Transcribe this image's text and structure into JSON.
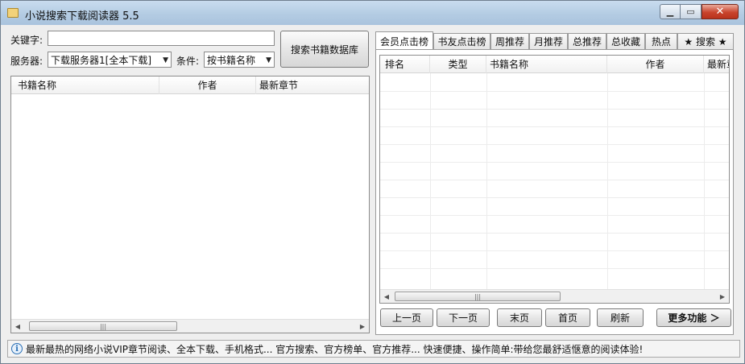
{
  "window": {
    "title": "小说搜索下载阅读器 5.5",
    "controls": {
      "minimize": "▁",
      "maximize": "▭",
      "close": "✕"
    }
  },
  "search": {
    "keyword_label": "关键字:",
    "keyword_value": "",
    "server_label": "服务器:",
    "server_value": "下载服务器1[全本下载]",
    "condition_label": "条件:",
    "condition_value": "按书籍名称",
    "search_button": "搜索书籍数据库"
  },
  "results": {
    "columns": [
      "书籍名称",
      "作者",
      "最新章节"
    ]
  },
  "ranking": {
    "tabs": [
      "会员点击榜",
      "书友点击榜",
      "周推荐",
      "月推荐",
      "总推荐",
      "总收藏",
      "热点",
      "★ 搜索 ★"
    ],
    "active_tab": 0,
    "columns": [
      "排名",
      "类型",
      "书籍名称",
      "作者",
      "最新章"
    ]
  },
  "pager": {
    "prev": "上一页",
    "next": "下一页",
    "last": "末页",
    "first": "首页",
    "refresh": "刷新",
    "more": "更多功能 ＞"
  },
  "status": {
    "text": "最新最热的网络小说VIP章节阅读、全本下载、手机格式... 官方搜索、官方榜单、官方推荐... 快速便捷、操作简单:带给您最舒适惬意的阅读体验!"
  },
  "icons": {
    "scroll_left": "◀",
    "scroll_right": "▶",
    "thumb_grip": "|||",
    "dropdown": "▼",
    "info": "i"
  }
}
